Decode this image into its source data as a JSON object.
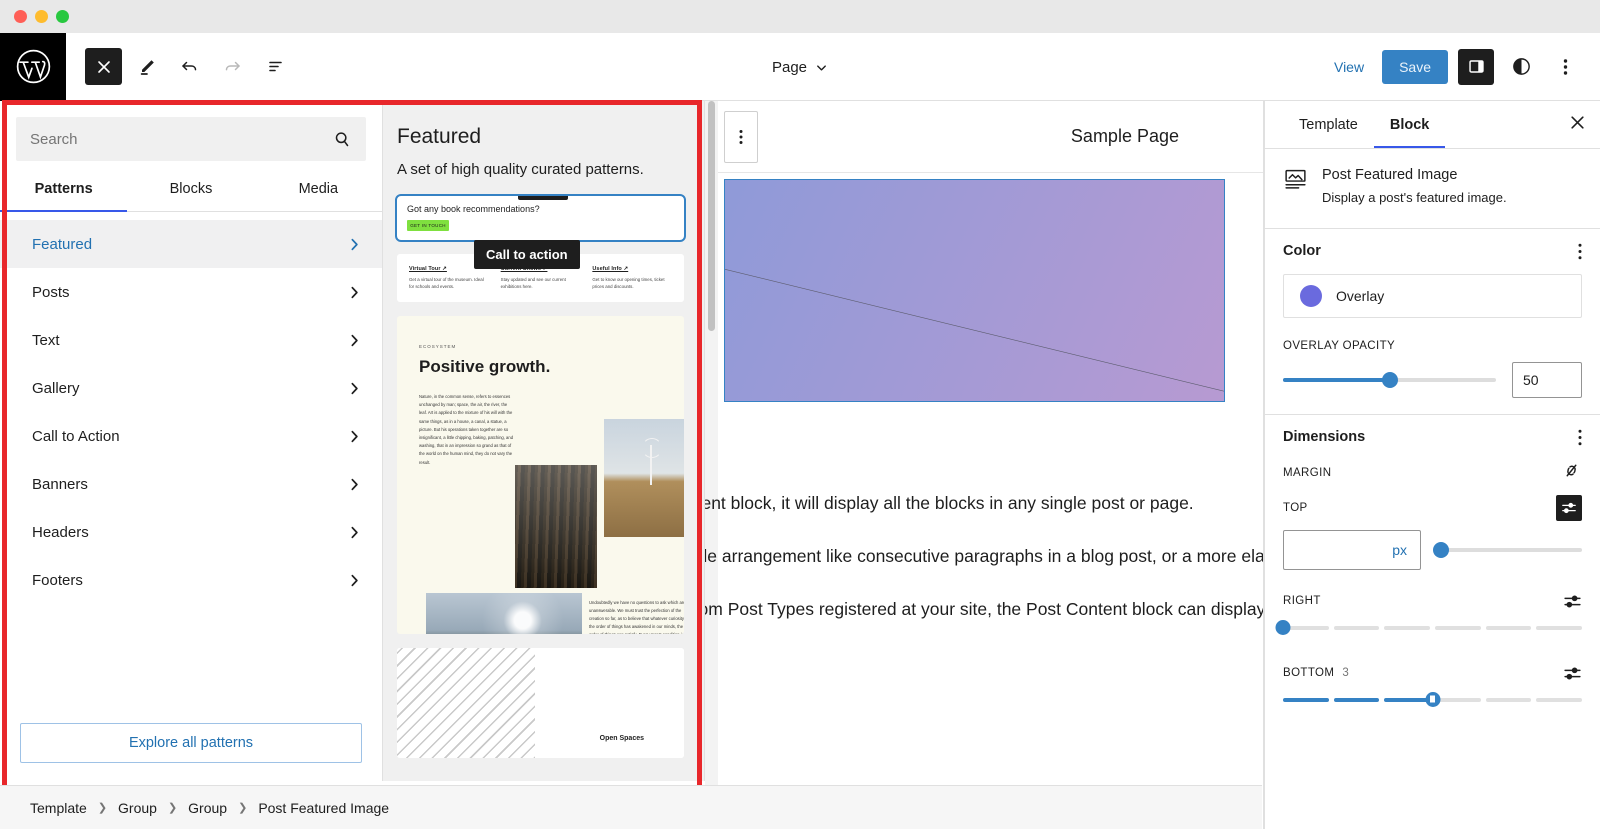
{
  "window": {
    "traffic_lights": [
      "close",
      "minimize",
      "zoom"
    ]
  },
  "header": {
    "logo": "wordpress-logo",
    "tools": [
      {
        "name": "close-inserter-button",
        "icon": "close-x-icon",
        "state": "active"
      },
      {
        "name": "edit-tool-button",
        "icon": "pencil-icon",
        "state": "default"
      },
      {
        "name": "undo-button",
        "icon": "undo-arrow-icon",
        "state": "default"
      },
      {
        "name": "redo-button",
        "icon": "redo-arrow-icon",
        "state": "disabled"
      },
      {
        "name": "list-view-button",
        "icon": "list-view-icon",
        "state": "default"
      }
    ],
    "document_title": "Page",
    "view_label": "View",
    "save_label": "Save",
    "sidebar_toggle_icon": "sidebar-panel-icon",
    "styles_icon": "contrast-circle-icon",
    "more_icon": "kebab-menu-icon",
    "save_bg": "#3582c4"
  },
  "inserter": {
    "search": {
      "value": "",
      "placeholder": "Search",
      "icon": "search-icon"
    },
    "tabs": [
      {
        "label": "Patterns",
        "active": true
      },
      {
        "label": "Blocks",
        "active": false
      },
      {
        "label": "Media",
        "active": false
      }
    ],
    "categories": [
      {
        "label": "Featured",
        "active": true
      },
      {
        "label": "Posts",
        "active": false
      },
      {
        "label": "Text",
        "active": false
      },
      {
        "label": "Gallery",
        "active": false
      },
      {
        "label": "Call to Action",
        "active": false
      },
      {
        "label": "Banners",
        "active": false
      },
      {
        "label": "Headers",
        "active": false
      },
      {
        "label": "Footers",
        "active": false
      }
    ],
    "explore_label": "Explore all patterns"
  },
  "pattern_preview": {
    "title": "Featured",
    "subtitle": "A set of high quality curated patterns.",
    "tooltip": "Call to action",
    "patterns": {
      "book": {
        "question": "Got any book recommendations?",
        "tag": "GET IN TOUCH"
      },
      "museum": {
        "columns": [
          {
            "title": "Virtual Tour ↗",
            "desc": "Get a virtual tour of the museum. Ideal for schools and events."
          },
          {
            "title": "Current Shows ↗",
            "desc": "Stay updated and see our current exhibitions here."
          },
          {
            "title": "Useful Info ↗",
            "desc": "Get to know our opening times, ticket prices and discounts."
          }
        ]
      },
      "growth": {
        "eyebrow": "ECOSYSTEM",
        "heading": "Positive growth.",
        "body": "Nature, in the common sense, refers to essences unchanged by man; space, the air, the river, the leaf. Art is applied to the mixture of his will with the same things, as in a house, a canal, a statue, a picture. But his operations taken together are so insignificant, a little chipping, baking, patching, and washing, that in an impression so grand as that of the world on the human mind, they do not vary the result.",
        "caption": "Undoubtedly we have no questions to ask which are unanswerable. We must trust the perfection of the creation so far, as to believe that whatever curiosity the order of things has awakened in our minds, the order of things can satisfy. Every man's condition is a solution in hieroglyphic to those inquiries he would put."
      },
      "open_spaces": {
        "label": "Open Spaces"
      }
    }
  },
  "canvas": {
    "block_options_icon": "vertical-kebab-icon",
    "page_title": "Sample Page",
    "featured_image_alt": "post-featured-image-placeholder",
    "paragraphs": [
      "This is the Post Content block, it will display all the blocks in any single post or page.",
      "That might be a simple arrangement like consecutive paragraphs in a blog post, or a more elaborate composition that includes image galleries, videos, tables, columns, and",
      "If there are any Custom Post Types registered at your site, the Post Content block can display the contents of those entries as well."
    ]
  },
  "inspector": {
    "tabs": [
      {
        "label": "Template",
        "active": false
      },
      {
        "label": "Block",
        "active": true
      }
    ],
    "close_icon": "close-x-icon",
    "block_card": {
      "icon": "post-featured-image-icon",
      "title": "Post Featured Image",
      "description": "Display a post's featured image."
    },
    "color": {
      "panel_title": "Color",
      "swatch_label": "Overlay",
      "swatch_hex": "#6a6ade",
      "opacity_label": "OVERLAY OPACITY",
      "opacity_value": "50",
      "opacity_percent": 50
    },
    "dimensions": {
      "panel_title": "Dimensions",
      "margin_label": "MARGIN",
      "link_icon": "unlink-sides-icon",
      "top": {
        "label": "TOP",
        "value": "",
        "unit": "px",
        "slider_percent": 3
      },
      "right": {
        "label": "RIGHT",
        "value": "",
        "segments_on": 0,
        "knob_percent": 0
      },
      "bottom": {
        "label": "BOTTOM",
        "value": "3",
        "segments_on": 3,
        "knob_percent": 50
      }
    }
  },
  "breadcrumb": [
    {
      "label": "Template"
    },
    {
      "label": "Group"
    },
    {
      "label": "Group"
    },
    {
      "label": "Post Featured Image"
    }
  ],
  "highlight": {
    "color": "#e8272b"
  }
}
